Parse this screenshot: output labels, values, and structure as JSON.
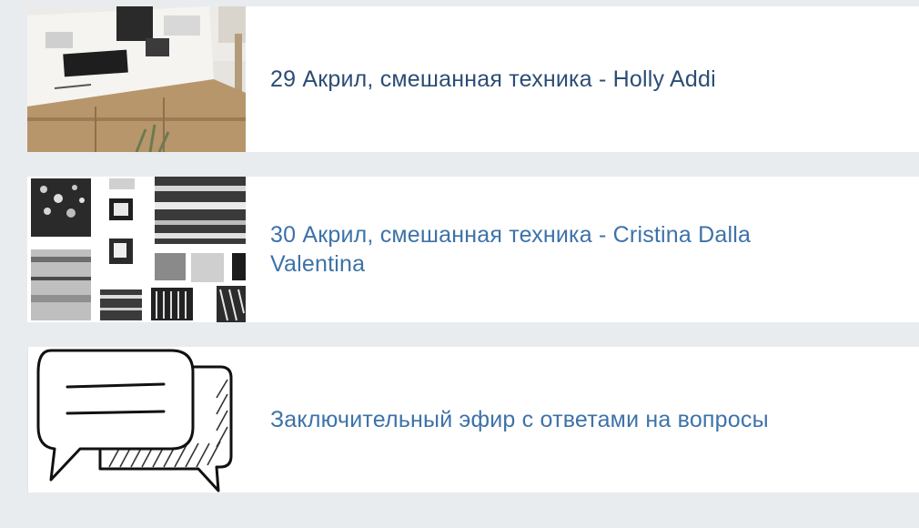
{
  "lessons": [
    {
      "title": "29 Акрил, смешанная техника - Holly Addi",
      "thumbnail_icon": "painting-thumbnail",
      "title_color": "#2b4d76"
    },
    {
      "title": "30 Акрил, смешанная техника - Cristina Dalla Valentina",
      "thumbnail_icon": "collage-thumbnail",
      "title_color": "#3d72a9"
    },
    {
      "title": "Заключительный эфир с ответами на вопросы",
      "thumbnail_icon": "chat-bubbles-icon",
      "title_color": "#3d72a9"
    }
  ],
  "colors": {
    "page_background": "#e9ecee",
    "card_background": "#ffffff"
  }
}
